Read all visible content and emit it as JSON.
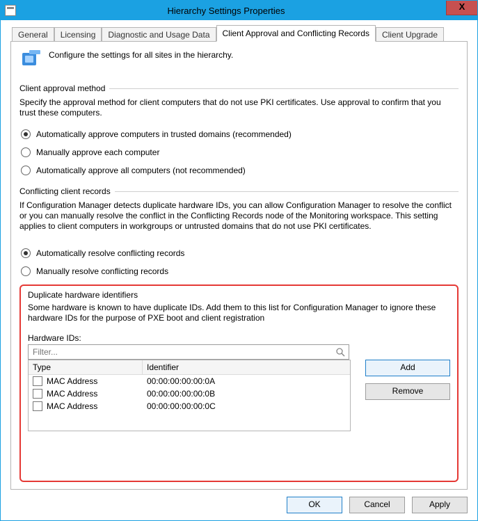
{
  "window": {
    "title": "Hierarchy Settings Properties",
    "close_button_label": "X"
  },
  "tabs": {
    "general": "General",
    "licensing": "Licensing",
    "diag": "Diagnostic and Usage Data",
    "approval": "Client Approval and Conflicting Records",
    "upgrade": "Client Upgrade"
  },
  "intro": {
    "text": "Configure the settings for all sites in the hierarchy."
  },
  "approval": {
    "heading": "Client approval method",
    "desc": "Specify the approval method for client computers that do not use PKI certificates. Use approval to confirm that you trust these computers.",
    "opt1": "Automatically approve computers in trusted domains (recommended)",
    "opt2": "Manually approve each computer",
    "opt3": "Automatically approve all computers (not recommended)"
  },
  "conflict": {
    "heading": "Conflicting client records",
    "desc": "If Configuration Manager detects duplicate hardware IDs, you can allow Configuration Manager to resolve the conflict or you can manually resolve the conflict in the Conflicting Records node of the Monitoring workspace. This setting applies to client computers in workgroups or untrusted domains that do not use PKI certificates.",
    "opt1": "Automatically resolve conflicting records",
    "opt2": "Manually resolve conflicting records"
  },
  "duplicate": {
    "heading": "Duplicate hardware identifiers",
    "desc": "Some hardware is known to have duplicate IDs. Add them to this list for Configuration Manager to ignore these hardware IDs for the purpose of PXE boot and client registration",
    "list_label": "Hardware IDs:",
    "filter_placeholder": "Filter...",
    "col_type": "Type",
    "col_identifier": "Identifier",
    "add_label": "Add",
    "remove_label": "Remove",
    "rows": [
      {
        "type": "MAC Address",
        "id": "00:00:00:00:00:0A"
      },
      {
        "type": "MAC Address",
        "id": "00:00:00:00:00:0B"
      },
      {
        "type": "MAC Address",
        "id": "00:00:00:00:00:0C"
      }
    ]
  },
  "buttons": {
    "ok": "OK",
    "cancel": "Cancel",
    "apply": "Apply"
  }
}
